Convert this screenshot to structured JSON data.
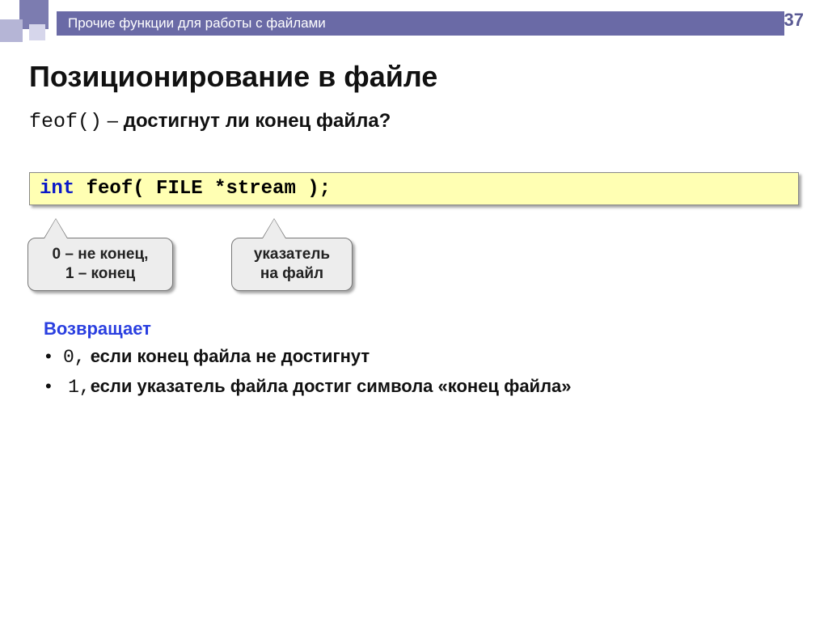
{
  "page_number": "37",
  "breadcrumb": "Прочие функции для работы с файлами",
  "title": "Позиционирование в файле",
  "subtitle": {
    "func": "feof()",
    "dash": " – ",
    "text": "достигнут ли конец файла?"
  },
  "code": {
    "kw": "int",
    "rest": " feof( FILE *stream );"
  },
  "callout1_line1": "0 – не конец,",
  "callout1_line2": "1 – конец",
  "callout2_line1": "указатель",
  "callout2_line2": "на файл",
  "returns_label": "Возвращает",
  "ret1_code": "0,",
  "ret1_text": " если конец файла не достигнут",
  "ret2_code": "1,",
  "ret2_text": "если указатель файла достиг символа «конец файла»"
}
